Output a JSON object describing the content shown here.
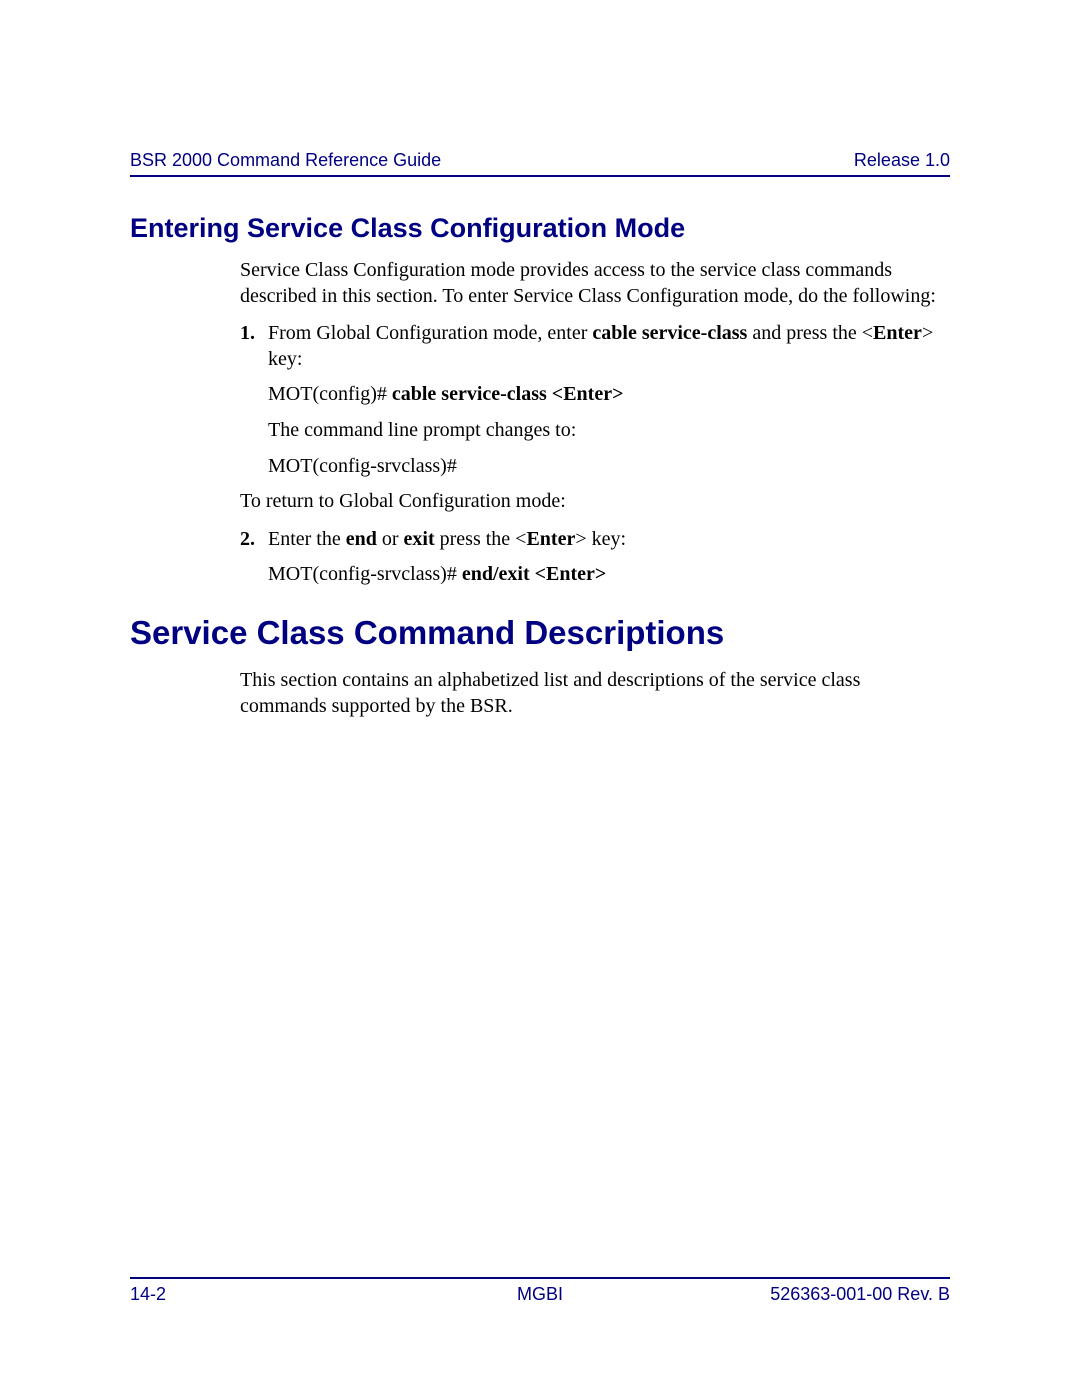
{
  "header": {
    "left": "BSR 2000 Command Reference Guide",
    "right": "Release 1.0"
  },
  "section1": {
    "heading": "Entering Service Class Configuration Mode",
    "intro": "Service Class Configuration mode provides access to the service class commands described in this section. To enter Service Class Configuration mode, do the following:",
    "step1": {
      "num": "1.",
      "pre": "From Global Configuration mode, enter ",
      "bold1": "cable service-class",
      "mid": " and press the <",
      "bold2": "Enter",
      "post": "> key:"
    },
    "cmd1_pre": "MOT(config)# ",
    "cmd1_bold": "cable service-class <Enter>",
    "prompt_note": "The command line prompt changes to:",
    "prompt": "MOT(config-srvclass)#",
    "return_note": "To return to Global Configuration mode:",
    "step2": {
      "num": "2.",
      "pre": "Enter the ",
      "bold1": "end",
      "mid1": " or ",
      "bold2": "exit",
      "mid2": " press the <",
      "bold3": "Enter",
      "post": "> key:"
    },
    "cmd2_pre": "MOT(config-srvclass)# ",
    "cmd2_bold": "end/exit <Enter>"
  },
  "section2": {
    "heading": "Service Class Command Descriptions",
    "intro": "This section contains an alphabetized list and descriptions of the service class commands supported by the BSR."
  },
  "footer": {
    "left": "14-2",
    "center": "MGBI",
    "right": "526363-001-00 Rev. B"
  }
}
